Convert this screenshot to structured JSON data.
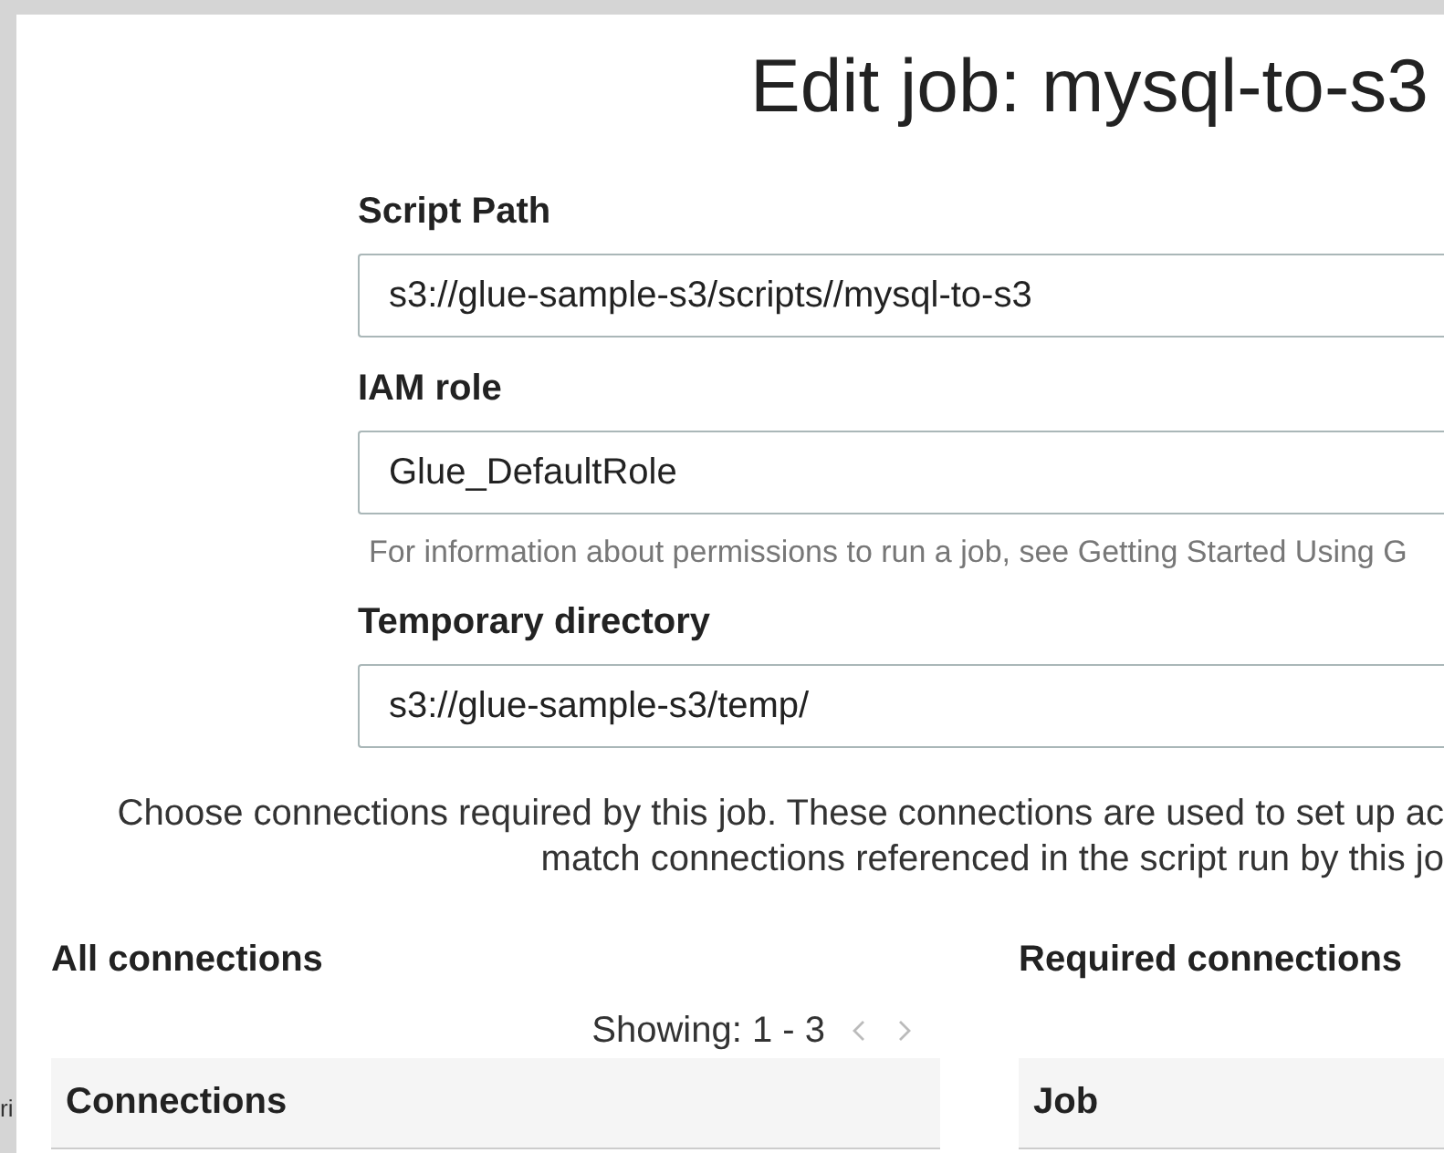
{
  "background_text": "ri",
  "title": "Edit job: mysql-to-s3",
  "fields": [
    {
      "label": "Script Path",
      "value": "s3://glue-sample-s3/scripts//mysql-to-s3"
    },
    {
      "label": "IAM role",
      "value": "Glue_DefaultRole",
      "hint": "For information about permissions to run a job, see Getting Started Using G"
    },
    {
      "label": "Temporary directory",
      "value": "s3://glue-sample-s3/temp/"
    }
  ],
  "intro_lines": [
    "Choose connections required by this job. These connections are used to set up ac",
    "match connections referenced in the script run by this jo"
  ],
  "all_connections": {
    "heading": "All connections",
    "pagination": "Showing: 1 - 3",
    "columns": [
      "Connections"
    ]
  },
  "required_connections": {
    "heading": "Required connections",
    "columns": [
      "Job"
    ]
  }
}
